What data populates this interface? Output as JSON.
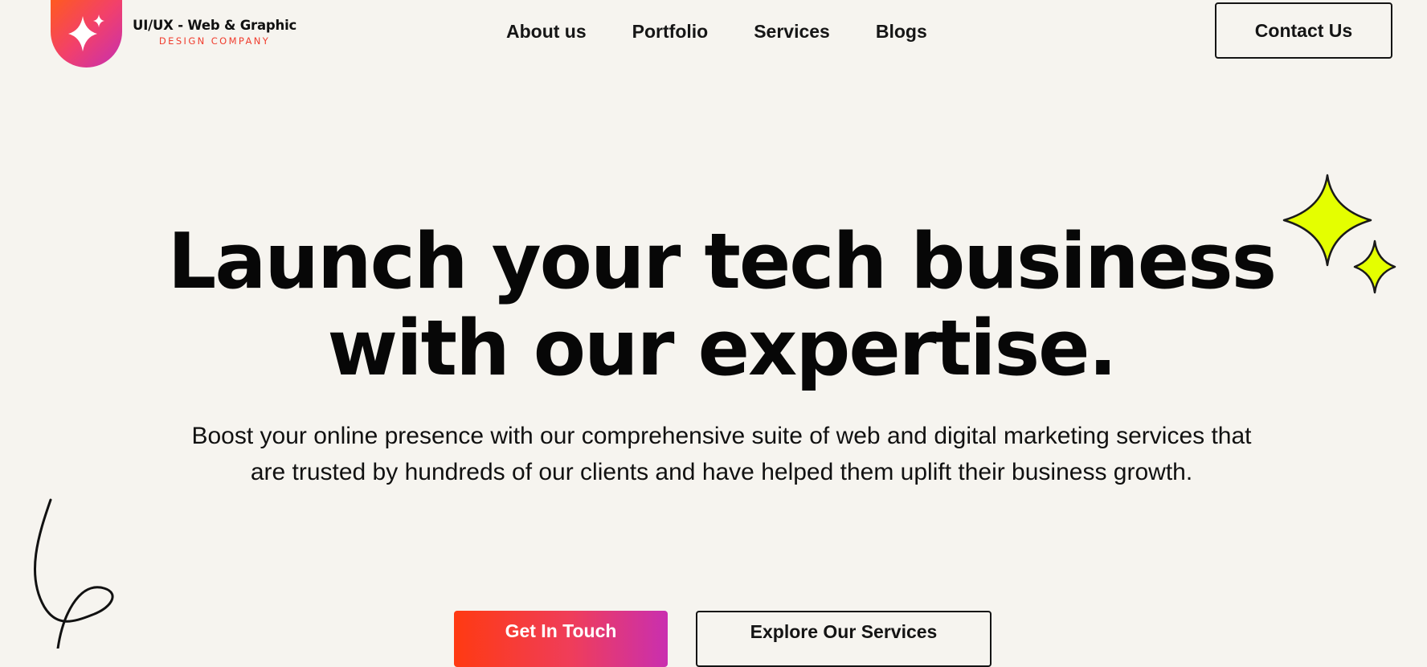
{
  "header": {
    "logo": {
      "title": "UI/UX - Web & Graphic",
      "subtitle": "DESIGN COMPANY",
      "icon": "sparkle-icon"
    },
    "nav": [
      {
        "label": "About us"
      },
      {
        "label": "Portfolio"
      },
      {
        "label": "Services"
      },
      {
        "label": "Blogs"
      }
    ],
    "contact_label": "Contact Us"
  },
  "hero": {
    "title_line1": "Launch your tech business",
    "title_line2": "with our expertise.",
    "subtitle": "Boost your online presence with our comprehensive suite of web and digital marketing services that are trusted by hundreds of our clients and have helped them uplift their business growth.",
    "primary_cta": "Get In Touch",
    "secondary_cta": "Explore Our Services",
    "decorations": [
      "four-point-star-icon",
      "squiggle-line"
    ]
  },
  "colors": {
    "background": "#f6f4ef",
    "gradient_start": "#ff3a12",
    "gradient_end": "#c92fb0",
    "star": "#e4ff00",
    "text": "#0d0d0d"
  }
}
